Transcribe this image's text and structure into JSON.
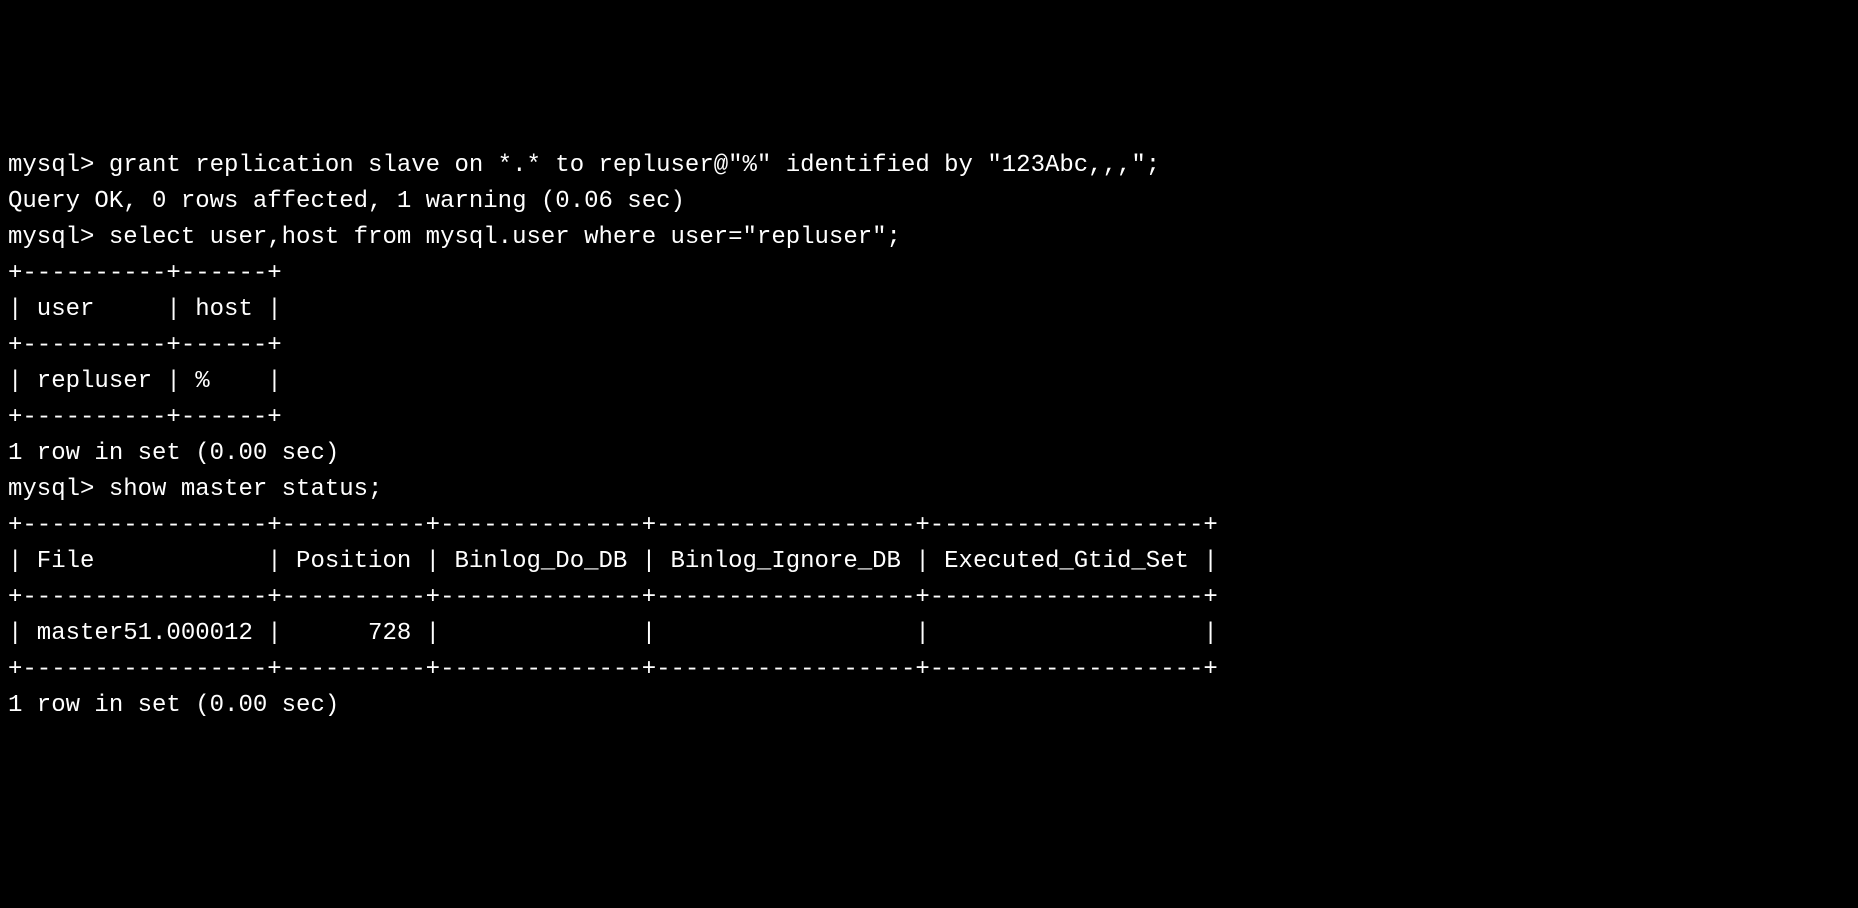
{
  "terminal": {
    "lines": [
      "mysql> grant replication slave on *.* to repluser@\"%\" identified by \"123Abc,,,\";",
      "Query OK, 0 rows affected, 1 warning (0.06 sec)",
      "",
      "mysql> select user,host from mysql.user where user=\"repluser\";",
      "+----------+------+",
      "| user     | host |",
      "+----------+------+",
      "| repluser | %    |",
      "+----------+------+",
      "1 row in set (0.00 sec)",
      "",
      "mysql> show master status;",
      "+-----------------+----------+--------------+------------------+-------------------+",
      "| File            | Position | Binlog_Do_DB | Binlog_Ignore_DB | Executed_Gtid_Set |",
      "+-----------------+----------+--------------+------------------+-------------------+",
      "| master51.000012 |      728 |              |                  |                   |",
      "+-----------------+----------+--------------+------------------+-------------------+",
      "1 row in set (0.00 sec)"
    ]
  },
  "commands": {
    "grant": {
      "prompt": "mysql>",
      "command": "grant replication slave on *.* to repluser@\"%\" identified by \"123Abc,,,\";",
      "result": "Query OK, 0 rows affected, 1 warning (0.06 sec)"
    },
    "select_user": {
      "prompt": "mysql>",
      "command": "select user,host from mysql.user where user=\"repluser\";",
      "table": {
        "columns": [
          "user",
          "host"
        ],
        "rows": [
          [
            "repluser",
            "%"
          ]
        ]
      },
      "result": "1 row in set (0.00 sec)"
    },
    "show_master": {
      "prompt": "mysql>",
      "command": "show master status;",
      "table": {
        "columns": [
          "File",
          "Position",
          "Binlog_Do_DB",
          "Binlog_Ignore_DB",
          "Executed_Gtid_Set"
        ],
        "rows": [
          [
            "master51.000012",
            "728",
            "",
            "",
            ""
          ]
        ]
      },
      "result": "1 row in set (0.00 sec)"
    }
  }
}
